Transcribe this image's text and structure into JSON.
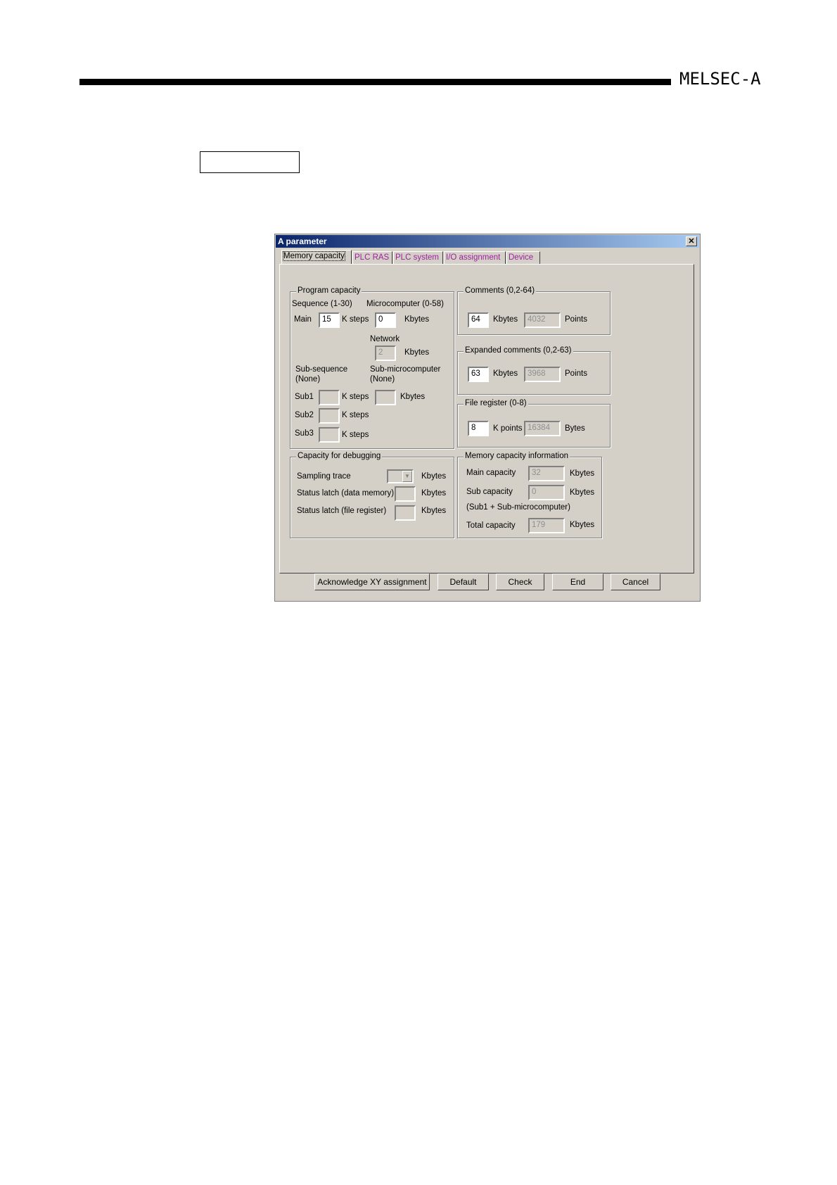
{
  "header": {
    "brand": "MELSEC-A"
  },
  "dialog": {
    "title": "A parameter",
    "close_glyph": "✕",
    "tabs": [
      {
        "label": "Memory capacity"
      },
      {
        "label": "PLC RAS"
      },
      {
        "label": "PLC system"
      },
      {
        "label": "I/O assignment"
      },
      {
        "label": "Device"
      }
    ],
    "program_capacity": {
      "title": "Program capacity",
      "sequence_label": "Sequence (1-30)",
      "microcomputer_label": "Microcomputer (0-58)",
      "main_label": "Main",
      "main_value": "15",
      "ksteps": "K steps",
      "micro_value": "0",
      "kbytes": "Kbytes",
      "network_label": "Network",
      "network_value": "2",
      "sub_sequence_label": "Sub-sequence",
      "sub_sequence_none": "(None)",
      "sub_micro_label": "Sub-microcomputer",
      "sub_micro_none": "(None)",
      "sub1": "Sub1",
      "sub2": "Sub2",
      "sub3": "Sub3"
    },
    "comments": {
      "title": "Comments (0,2-64)",
      "value": "64",
      "unit": "Kbytes",
      "points_value": "4032",
      "points_label": "Points"
    },
    "expanded_comments": {
      "title": "Expanded comments (0,2-63)",
      "value": "63",
      "unit": "Kbytes",
      "points_value": "3968",
      "points_label": "Points"
    },
    "file_register": {
      "title": "File register (0-8)",
      "value": "8",
      "unit": "K points",
      "bytes_value": "16384",
      "bytes_label": "Bytes"
    },
    "debugging": {
      "title": "Capacity for debugging",
      "sampling_trace": "Sampling trace",
      "status_latch_data": "Status latch (data memory)",
      "status_latch_file": "Status latch (file register)",
      "unit": "Kbytes"
    },
    "memory_info": {
      "title": "Memory capacity information",
      "main_capacity": "Main capacity",
      "main_value": "32",
      "sub_capacity": "Sub capacity",
      "sub_value": "0",
      "sub_note": "(Sub1 + Sub-microcomputer)",
      "total_capacity": "Total capacity",
      "total_value": "179",
      "unit": "Kbytes"
    },
    "buttons": {
      "ack": "Acknowledge XY assignment",
      "default": "Default",
      "check": "Check",
      "end": "End",
      "cancel": "Cancel"
    }
  }
}
